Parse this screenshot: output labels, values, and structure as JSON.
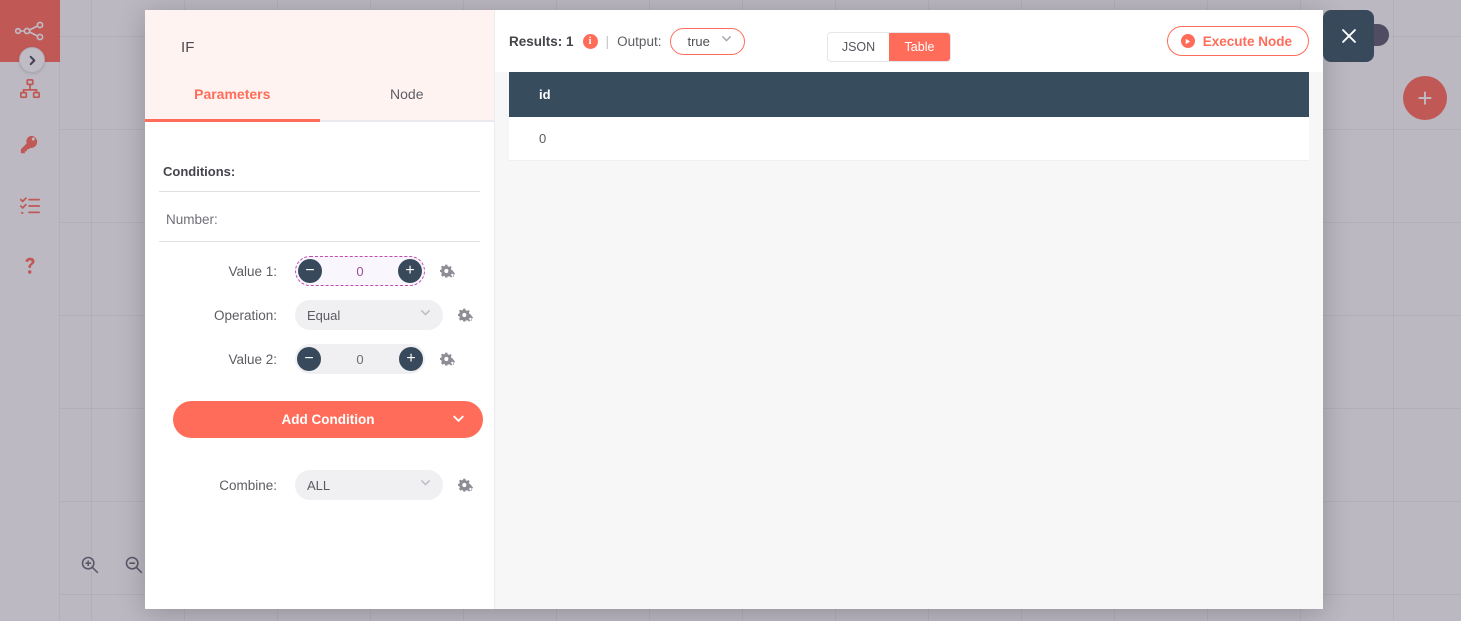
{
  "app": {
    "rail": {
      "logo_icon": "workflow-graph-icon",
      "expand_icon": "chevron-right-icon",
      "items": [
        {
          "icon": "sitemap-icon",
          "name": "workflows"
        },
        {
          "icon": "key-icon",
          "name": "credentials"
        },
        {
          "icon": "checklist-icon",
          "name": "executions"
        },
        {
          "icon": "question-mark-icon",
          "name": "help"
        }
      ]
    },
    "canvas": {
      "zoom_in_icon": "zoom-in-icon",
      "zoom_out_icon": "zoom-out-icon",
      "add_node_label": "+",
      "add_node_icon": "plus-icon"
    }
  },
  "ndv": {
    "close_icon": "close-icon",
    "parameters": {
      "node_title": "IF",
      "tabs": [
        {
          "label": "Parameters",
          "active": true
        },
        {
          "label": "Node",
          "active": false
        }
      ],
      "conditions_label": "Conditions:",
      "condition_group_label": "Number:",
      "rows": [
        {
          "label": "Value 1:",
          "control": "stepper",
          "value": "0",
          "focused": true,
          "minus_label": "−",
          "plus_label": "+",
          "options_icon": "gear-options-icon"
        },
        {
          "label": "Operation:",
          "control": "select",
          "value": "Equal",
          "chevron_icon": "chevron-down-icon",
          "options_icon": "gear-options-icon"
        },
        {
          "label": "Value 2:",
          "control": "stepper",
          "value": "0",
          "focused": false,
          "minus_label": "−",
          "plus_label": "+",
          "options_icon": "gear-options-icon"
        }
      ],
      "add_condition_label": "Add Condition",
      "add_condition_chevron_icon": "chevron-down-icon",
      "combine_label": "Combine:",
      "combine_value": "ALL",
      "combine_chevron_icon": "chevron-down-icon",
      "combine_options_icon": "gear-options-icon"
    },
    "output": {
      "results_label": "Results: 1",
      "info_icon": "info-icon",
      "info_glyph": "i",
      "separator": "|",
      "output_label": "Output:",
      "branch_value": "true",
      "branch_chevron_icon": "chevron-down-icon",
      "view_modes": [
        {
          "label": "JSON",
          "active": false
        },
        {
          "label": "Table",
          "active": true
        }
      ],
      "execute_label": "Execute Node",
      "execute_icon": "play-icon",
      "table": {
        "columns": [
          "id"
        ],
        "rows": [
          [
            "0"
          ]
        ]
      }
    }
  },
  "colors": {
    "accent": "#ff6d5a",
    "dark": "#37495a",
    "focus_dashed": "#c24ab0",
    "panel_head": "#fef3f0",
    "output_bg": "#f7f7f8"
  }
}
